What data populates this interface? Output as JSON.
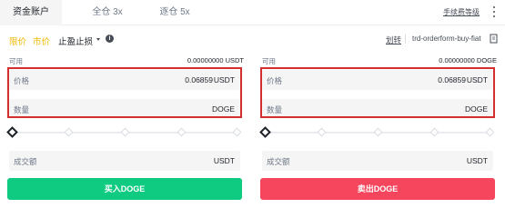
{
  "tabs": {
    "items": [
      {
        "label": "资金账户",
        "active": true
      },
      {
        "label": "全仓 3x",
        "active": false
      },
      {
        "label": "逐仓 5x",
        "active": false
      }
    ],
    "fee_link": "手续费等级"
  },
  "order_type": {
    "limit": "限价",
    "market": "市价",
    "stop": "止盈止损",
    "convert": "划转",
    "tag": "trd-orderform-buy-fiat"
  },
  "buy": {
    "available_label": "可用",
    "available_value": "0.00000000 USDT",
    "price_label": "价格",
    "price_value": "0.06859",
    "price_unit": "USDT",
    "qty_label": "数量",
    "qty_unit": "DOGE",
    "total_label": "成交额",
    "total_unit": "USDT",
    "button_label": "买入DOGE"
  },
  "sell": {
    "available_label": "可用",
    "available_value": "0.00000000 DOGE",
    "price_label": "价格",
    "price_value": "0.06859",
    "price_unit": "USDT",
    "qty_label": "数量",
    "qty_unit": "DOGE",
    "total_label": "成交额",
    "total_unit": "USDT",
    "button_label": "卖出DOGE"
  },
  "colors": {
    "accent": "#f0b90b",
    "buy": "#0ecb81",
    "sell": "#f6465d",
    "highlight": "#d32f2f"
  },
  "icons": [
    "more-vertical-icon",
    "caret-down-icon",
    "info-icon",
    "edit-icon",
    "slider-handle-icon"
  ]
}
